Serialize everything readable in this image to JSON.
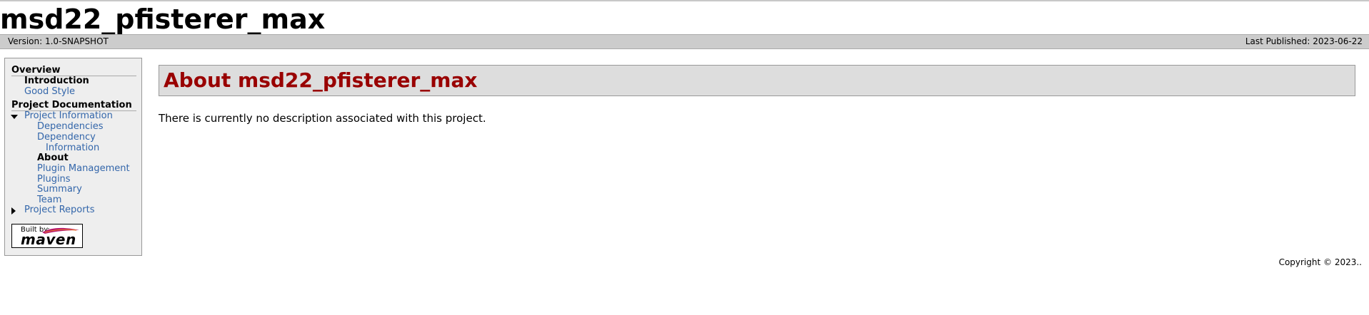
{
  "banner": {
    "project_name": "msd22_pfisterer_max"
  },
  "breadcrumbs": {
    "version": "Version: 1.0-SNAPSHOT",
    "published": "Last Published: 2023-06-22"
  },
  "sidebar": {
    "overview_heading": "Overview",
    "overview_items": [
      {
        "label": "Introduction",
        "current": true
      },
      {
        "label": "Good Style",
        "current": false
      }
    ],
    "docs_heading": "Project Documentation",
    "project_information": "Project Information",
    "pi_items": [
      {
        "label": "Dependencies"
      },
      {
        "label": "Dependency"
      },
      {
        "label": "Information"
      },
      {
        "label": "About"
      },
      {
        "label": "Plugin Management"
      },
      {
        "label": "Plugins"
      },
      {
        "label": "Summary"
      },
      {
        "label": "Team"
      }
    ],
    "project_reports": "Project Reports",
    "built_by": "Built by:",
    "maven": "maven"
  },
  "main": {
    "heading": "About msd22_pfisterer_max",
    "description": "There is currently no description associated with this project."
  },
  "footer": {
    "copyright": "Copyright © 2023.."
  },
  "colors": {
    "link": "#3366aa",
    "heading": "#990000",
    "bar": "#cccccc"
  },
  "icons": {
    "expanded": "triangle-down-icon",
    "collapsed": "triangle-right-icon"
  }
}
